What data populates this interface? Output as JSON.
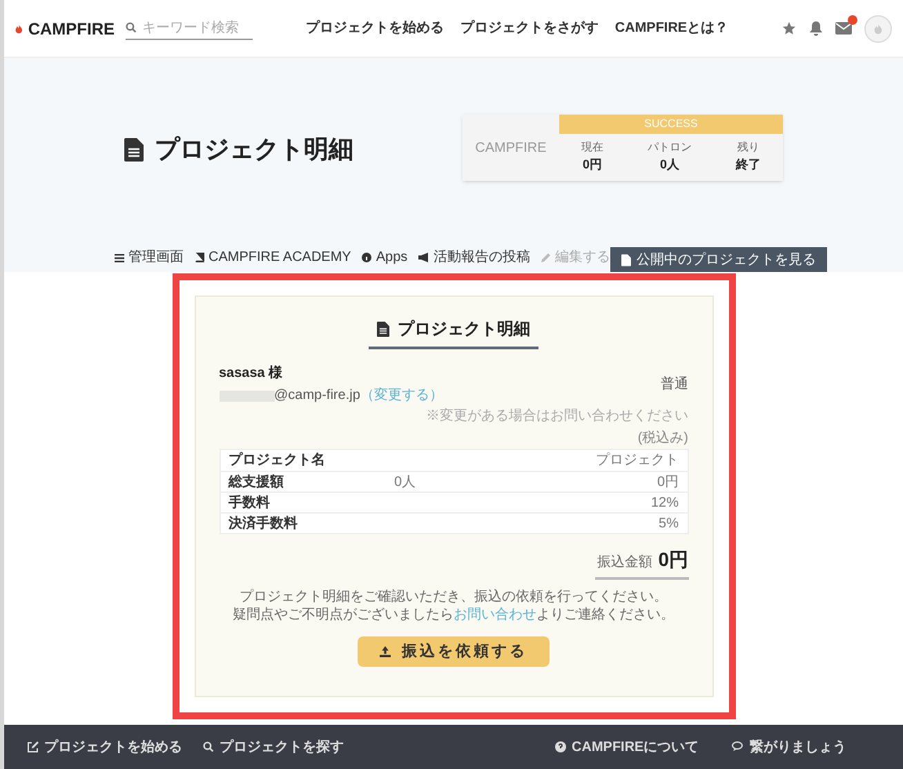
{
  "header": {
    "logo": "CAMPFIRE",
    "search": {
      "placeholder": "キーワード検索"
    },
    "nav": [
      "プロジェクトを始める",
      "プロジェクトをさがす",
      "CAMPFIREとは？"
    ]
  },
  "hero": {
    "title": "プロジェクト明細",
    "stats": {
      "logo": "CAMPFIRE",
      "status": "SUCCESS",
      "items": [
        {
          "label": "現在",
          "value": "0円"
        },
        {
          "label": "パトロン",
          "value": "0人"
        },
        {
          "label": "残り",
          "value": "終了"
        }
      ]
    },
    "tabs": [
      {
        "label": "管理画面",
        "disabled": false
      },
      {
        "label": "CAMPFIRE ACADEMY",
        "disabled": false
      },
      {
        "label": "Apps",
        "disabled": false
      },
      {
        "label": "活動報告の投稿",
        "disabled": false
      },
      {
        "label": "編集する",
        "disabled": true
      }
    ],
    "view_button": "公開中のプロジェクトを見る"
  },
  "statement": {
    "title": "プロジェクト明細",
    "customer": "sasasa 様",
    "email": "@camp-fire.jp",
    "change_link": "（変更する）",
    "account_type": "普通",
    "account_note": "※変更がある場合はお問い合わせください",
    "tax_note": "(税込み)",
    "rows": [
      {
        "label": "プロジェクト名",
        "column_2": "",
        "value": "プロジェクト"
      },
      {
        "label": "総支援額",
        "column_2": "0人",
        "value": "0円"
      },
      {
        "label": "手数料",
        "column_2": "",
        "value": "12%"
      },
      {
        "label": "決済手数料",
        "column_2": "",
        "value": "5%"
      }
    ],
    "total_label": "振込金額",
    "total_value": "0円",
    "message_line_1": "プロジェクト明細をご確認いただき、振込の依頼を行ってください。",
    "message_line_2": {
      "before": "疑問点やご不明点がございましたら",
      "link": "お問い合わせ",
      "after": "よりご連絡ください。"
    },
    "button": "振込を依頼する"
  },
  "footer": [
    "プロジェクトを始める",
    "プロジェクトを探す",
    "CAMPFIREについて",
    "繋がりましょう"
  ]
}
